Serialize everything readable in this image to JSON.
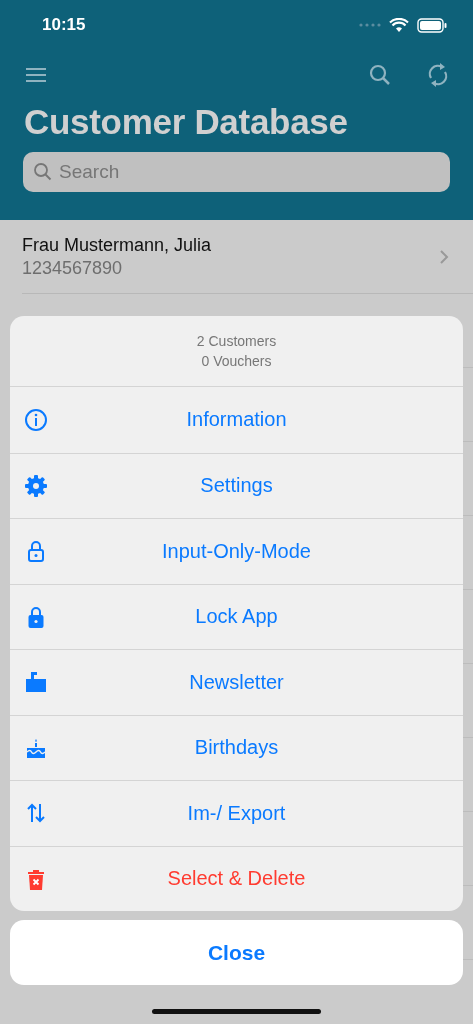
{
  "status_bar": {
    "time": "10:15"
  },
  "nav": {
    "title": "Customer Database",
    "search": {
      "placeholder": "Search"
    }
  },
  "customers": [
    {
      "name": "Frau Mustermann, Julia",
      "number": "1234567890"
    }
  ],
  "action_sheet": {
    "summary": [
      "2 Customers",
      "0 Vouchers"
    ],
    "actions": [
      {
        "label": "Information",
        "kind": "info",
        "destructive": false
      },
      {
        "label": "Settings",
        "kind": "gear",
        "destructive": false
      },
      {
        "label": "Input-Only-Mode",
        "kind": "padlock",
        "destructive": false
      },
      {
        "label": "Lock App",
        "kind": "lock",
        "destructive": false
      },
      {
        "label": "Newsletter",
        "kind": "mailbox",
        "destructive": false
      },
      {
        "label": "Birthdays",
        "kind": "cake",
        "destructive": false
      },
      {
        "label": "Im-/ Export",
        "kind": "arrows",
        "destructive": false
      },
      {
        "label": "Select & Delete",
        "kind": "trash",
        "destructive": true
      }
    ],
    "close": "Close"
  }
}
